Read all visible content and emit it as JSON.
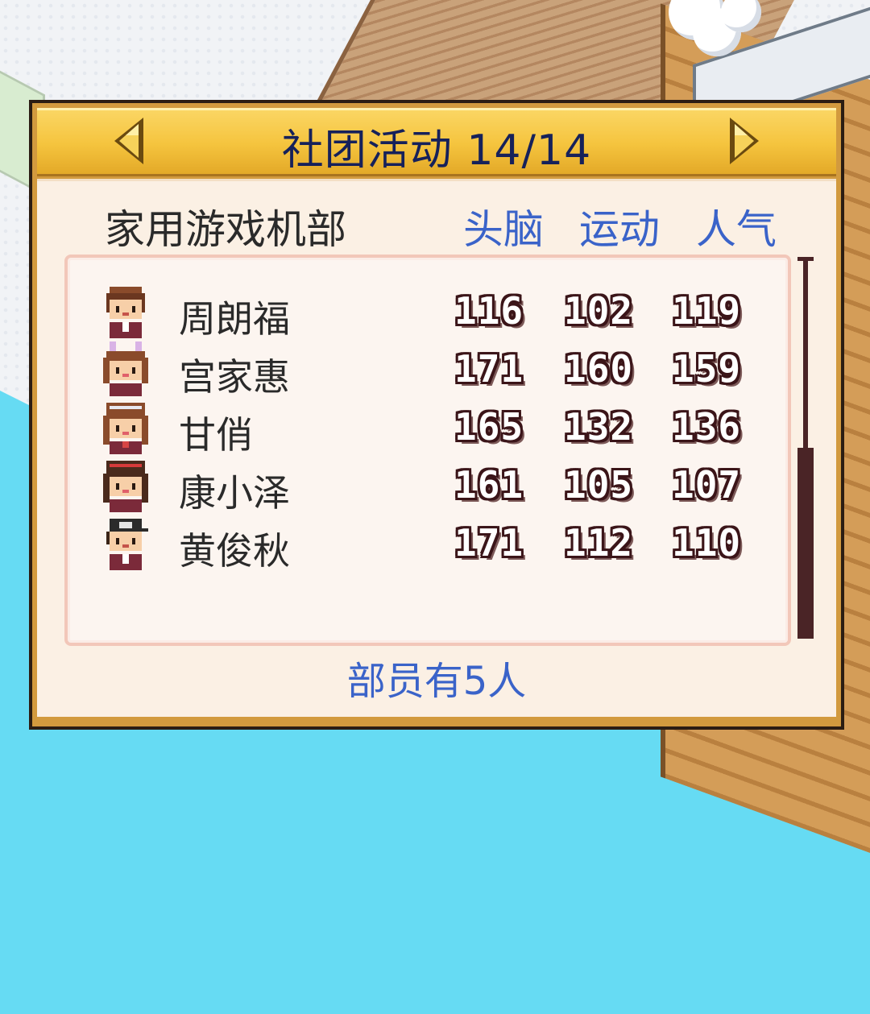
{
  "dialog": {
    "title": "社团活动 14/14",
    "club_name": "家用游戏机部",
    "columns": [
      "头脑",
      "运动",
      "人气"
    ],
    "members": [
      {
        "name": "周朗福",
        "stats": [
          "116",
          "102",
          "119"
        ],
        "avatar": "boy-brown-hair"
      },
      {
        "name": "宫家惠",
        "stats": [
          "171",
          "160",
          "159"
        ],
        "avatar": "girl-bunny-ears"
      },
      {
        "name": "甘俏",
        "stats": [
          "165",
          "132",
          "136"
        ],
        "avatar": "girl-headband"
      },
      {
        "name": "康小泽",
        "stats": [
          "161",
          "105",
          "107"
        ],
        "avatar": "girl-red-band"
      },
      {
        "name": "黄俊秋",
        "stats": [
          "171",
          "112",
          "110"
        ],
        "avatar": "boy-cap"
      }
    ],
    "member_count": "部员有5人",
    "scroll_position": 0.5
  },
  "colors": {
    "title_bar": "#f5c43e",
    "title_text": "#16215a",
    "accent_blue": "#3a63c9",
    "panel": "#fbf0e4",
    "frame": "#d29a3e"
  }
}
